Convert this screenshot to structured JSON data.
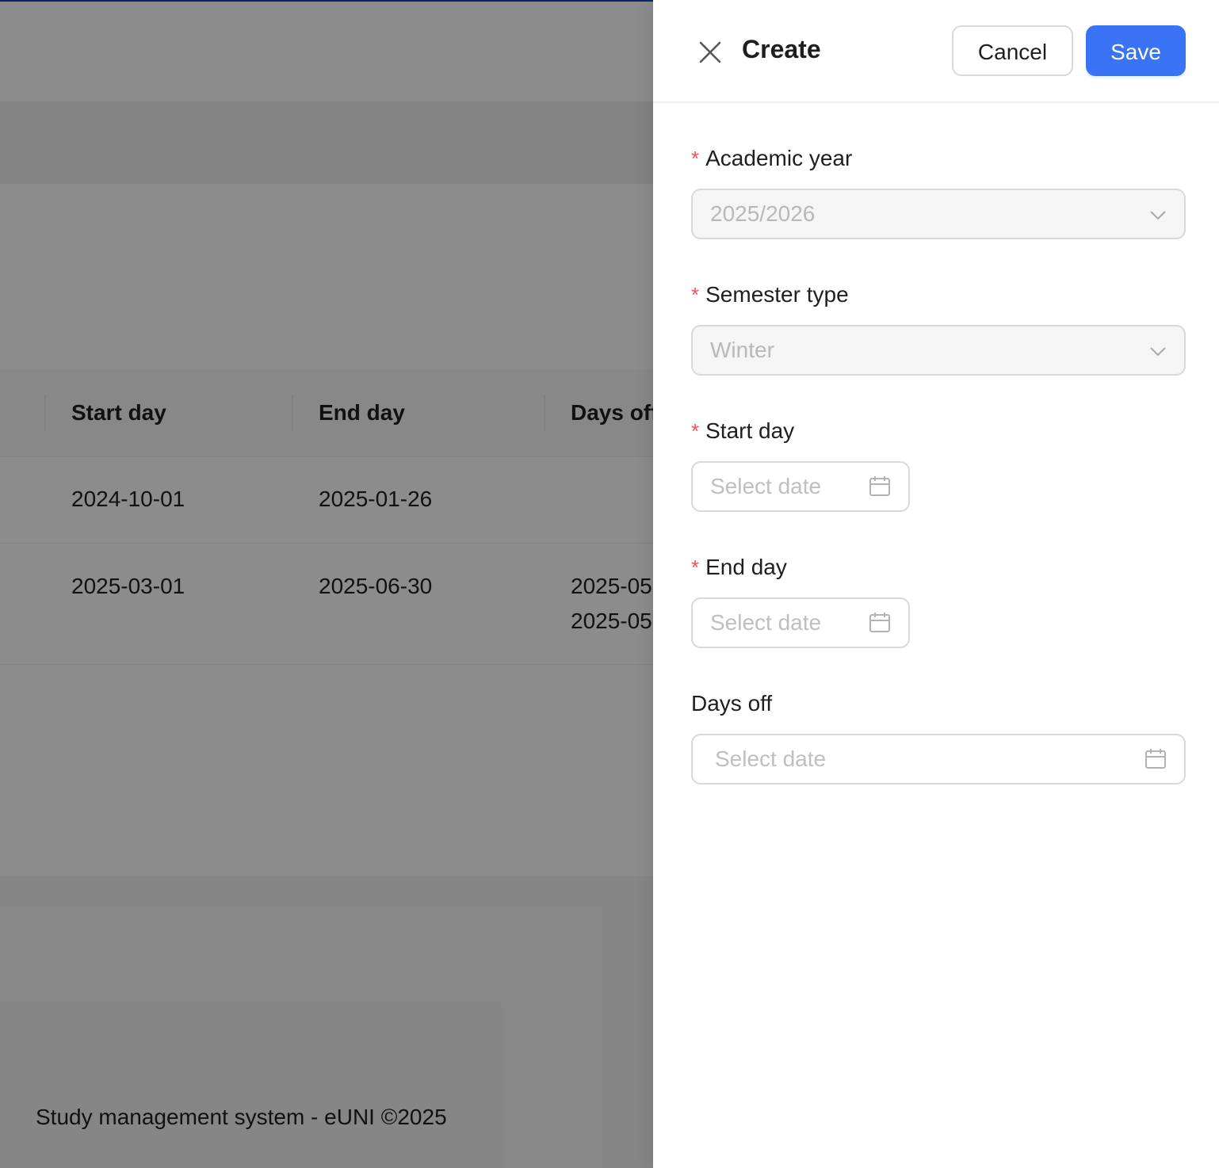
{
  "background": {
    "table": {
      "headers": [
        "Start day",
        "End day",
        "Days off"
      ],
      "rows": [
        {
          "start": "2024-10-01",
          "end": "2025-01-26",
          "days_off": [
            "",
            ""
          ]
        },
        {
          "start": "2025-03-01",
          "end": "2025-06-30",
          "days_off": [
            "2025-05",
            "2025-05"
          ]
        }
      ]
    },
    "footer": "Study management system - eUNI ©2025"
  },
  "drawer": {
    "title": "Create",
    "cancel_label": "Cancel",
    "save_label": "Save",
    "close_icon": "close-icon",
    "fields": {
      "academic_year": {
        "label": "Academic year",
        "required": true,
        "value": "2025/2026",
        "disabled": true
      },
      "semester_type": {
        "label": "Semester type",
        "required": true,
        "value": "Winter",
        "disabled": true
      },
      "start_day": {
        "label": "Start day",
        "required": true,
        "placeholder": "Select date"
      },
      "end_day": {
        "label": "End day",
        "required": true,
        "placeholder": "Select date"
      },
      "days_off": {
        "label": "Days off",
        "required": false,
        "placeholder": "Select date"
      }
    },
    "required_mark": "*"
  },
  "colors": {
    "primary": "#3a73f5",
    "required": "#ff4d4f",
    "overlay": "rgba(0,0,0,0.45)",
    "topline": "#1d3fbf"
  }
}
